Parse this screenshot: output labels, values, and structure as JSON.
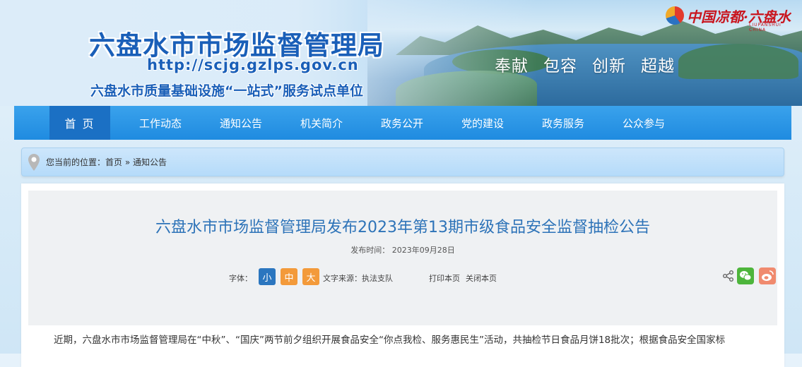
{
  "banner": {
    "org_title": "六盘水市市场监督管理局",
    "url": "http://scjg.gzlps.gov.cn",
    "pilot": "六盘水市质量基础设施“一站式”服务试点单位",
    "slogans": [
      "奉献",
      "包容",
      "创新",
      "超越"
    ],
    "brand_text": "中国凉都·六盘水",
    "brand_sub": "LIUPANSHUI CHINA"
  },
  "nav": {
    "items": [
      "首 页",
      "工作动态",
      "通知公告",
      "机关简介",
      "政务公开",
      "党的建设",
      "政务服务",
      "公众参与"
    ],
    "active_index": 0
  },
  "breadcrumb": {
    "prefix": "您当前的位置：",
    "home": "首页",
    "sep": "»",
    "current": "通知公告"
  },
  "article": {
    "title": "六盘水市市场监督管理局发布2023年第13期市级食品安全监督抽检公告",
    "pubdate_label": "发布时间：",
    "pubdate": "2023年09月28日",
    "font_label": "字体：",
    "font_small": "小",
    "font_medium": "中",
    "font_large": "大",
    "source_label": "文字来源：",
    "source": "执法支队",
    "print": "打印本页",
    "close": "关闭本页",
    "body": "近期，六盘水市市场监督管理局在“中秋”、“国庆”两节前夕组织开展食品安全“你点我检、服务惠民生”活动，共抽检节日食品月饼18批次；根据食品安全国家标"
  },
  "colors": {
    "nav": "#1f8be0",
    "nav_active": "#1b70c4",
    "title": "#2d73b8",
    "wechat": "#4db53b",
    "weibo": "#f08a6e"
  }
}
